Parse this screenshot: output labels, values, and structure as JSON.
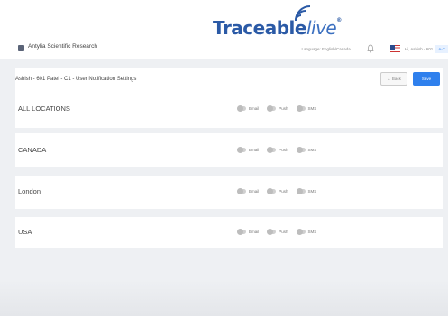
{
  "brand": {
    "name": "Traceable",
    "suffix": "live",
    "mark": "®"
  },
  "header": {
    "app_name": "Antylia Scientific Research",
    "language": "Language: English/Canada",
    "user": "Hi, Ashish - 601",
    "user_badge": "A-C"
  },
  "page": {
    "title": "Ashish - 601 Patel - C1 - User Notification Settings",
    "back_label": "← Back",
    "save_label": "Save"
  },
  "toggle_labels": [
    "Email",
    "Push",
    "SMS"
  ],
  "locations": [
    {
      "name": "ALL LOCATIONS"
    },
    {
      "name": "CANADA"
    },
    {
      "name": "London"
    },
    {
      "name": "USA"
    }
  ],
  "colors": {
    "accent": "#2f80ed",
    "brand": "#2b5aa6"
  }
}
